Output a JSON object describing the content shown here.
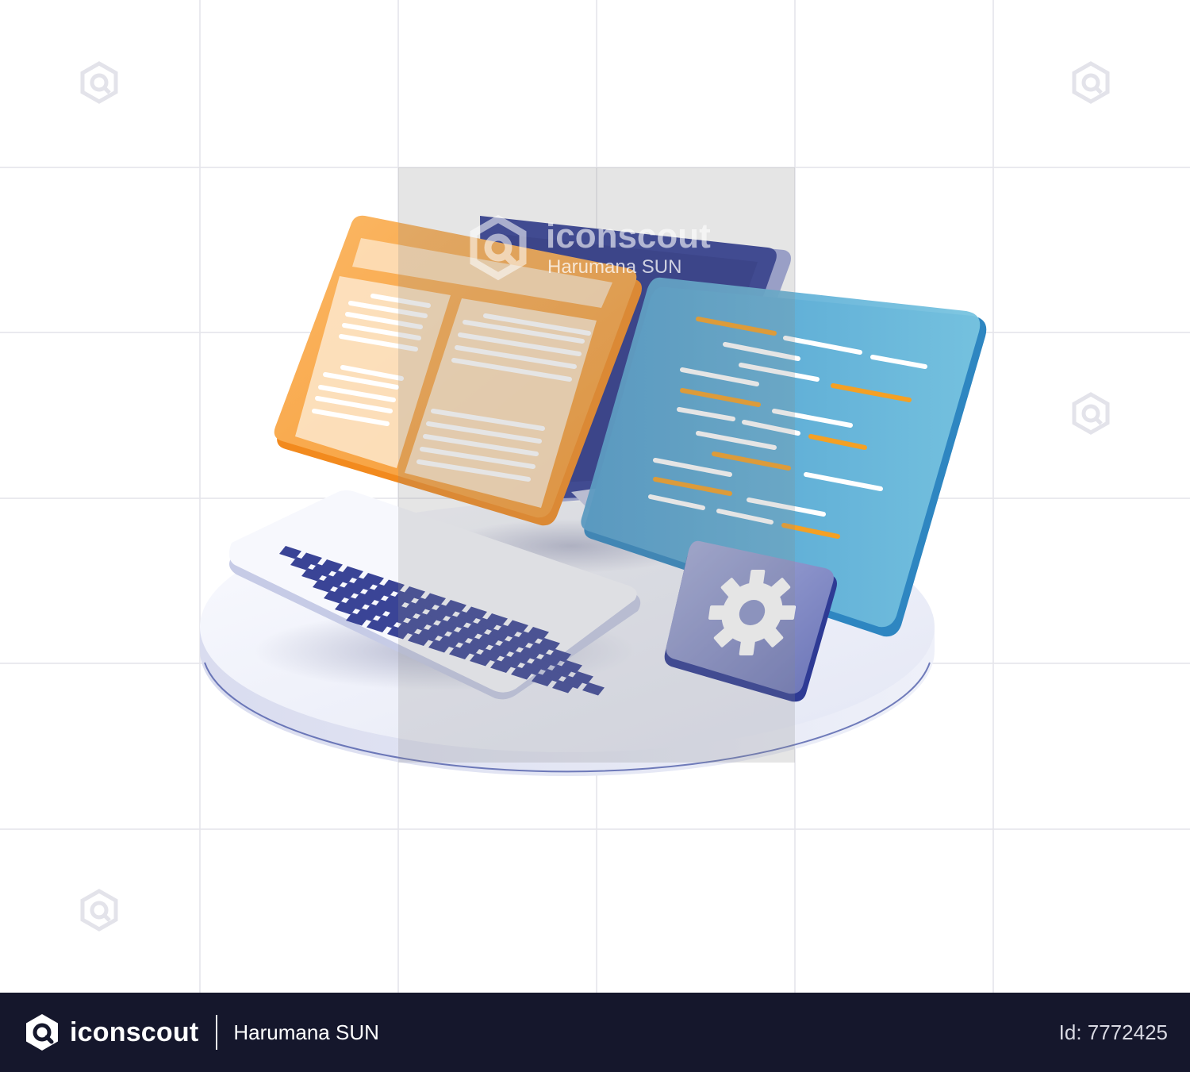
{
  "watermark": {
    "brand": "iconscout",
    "author": "Harumana SUN"
  },
  "footer": {
    "brand": "iconscout",
    "author": "Harumana SUN",
    "asset_id": "Id: 7772425"
  },
  "colors": {
    "footer_bg": "#15172c",
    "orange_panel": "#f7a53c",
    "blue_panel": "#5fb4da",
    "monitor_navy": "#2e3a94",
    "keyboard_keys": "#3a4496",
    "gear_tile": "#7f88c4",
    "platform": "#eceef8",
    "code_orange": "#f4a024"
  },
  "icons": [
    "iconscout-logo-icon",
    "gear-icon",
    "keyboard-icon",
    "monitor-icon"
  ]
}
